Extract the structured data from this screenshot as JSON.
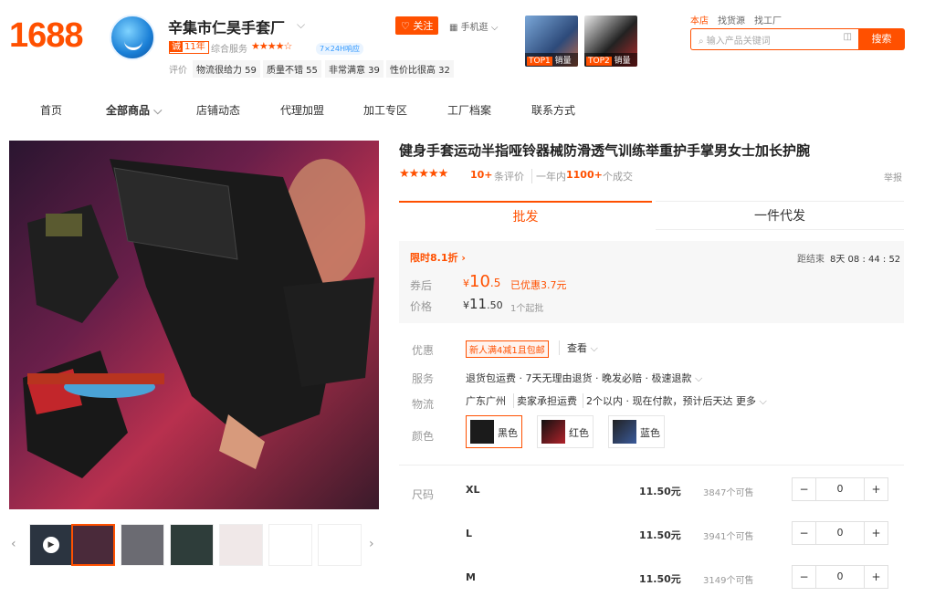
{
  "logo": "1688",
  "shop": {
    "name": "辛集市仁昊手套厂",
    "years_badge_icon": "诚",
    "years": "11年",
    "overall_service_label": "综合服务",
    "stars": "★★★★☆",
    "service_badge": "7×24H响应",
    "follow_label": "关注",
    "mobile_label": "手机逛",
    "eval_label": "评价",
    "evaluations": [
      "物流很给力 59",
      "质量不错 55",
      "非常满意 39",
      "性价比很高 32"
    ]
  },
  "top_products": [
    {
      "rank": "TOP1",
      "label": "销量"
    },
    {
      "rank": "TOP2",
      "label": "销量"
    }
  ],
  "header_links": [
    "本店",
    "找货源",
    "找工厂"
  ],
  "search": {
    "placeholder": "输入产品关键词",
    "button": "搜索"
  },
  "nav": [
    "首页",
    "全部商品",
    "店铺动态",
    "代理加盟",
    "加工专区",
    "工厂档案",
    "联系方式"
  ],
  "product": {
    "title": "健身手套运动半指哑铃器械防滑透气训练举重护手掌男女士加长护腕",
    "rating_stars": "★★★★★",
    "reviews_count": "10+",
    "reviews_label": "条评价",
    "year_label": "一年内",
    "year_sales": "1100+",
    "deals_label": "个成交",
    "report": "举报"
  },
  "tabs": [
    "批发",
    "一件代发"
  ],
  "promo": {
    "label": "限时8.1折",
    "countdown_label": "距结束",
    "countdown": "8天 08 : 44 : 52",
    "coupon_label": "券后",
    "coupon_currency": "¥",
    "coupon_int": "10",
    "coupon_dec": ".5",
    "discount": "已优惠3.7元",
    "price_label": "价格",
    "price_currency": "¥",
    "price_int": "11",
    "price_dec": ".50",
    "moq": "1个起批"
  },
  "offers": {
    "label": "优惠",
    "tag": "新人满4减1且包邮",
    "view": "查看"
  },
  "service": {
    "label": "服务",
    "text": "退货包运费 · 7天无理由退货 · 晚发必赔 · 极速退款"
  },
  "logistics": {
    "label": "物流",
    "location": "广东广州",
    "fee": "卖家承担运费",
    "shipping": "2个以内 · 现在付款，预计后天达",
    "more": "更多"
  },
  "colors": {
    "label": "颜色",
    "options": [
      "黑色",
      "红色",
      "蓝色"
    ]
  },
  "sizes": {
    "label": "尺码",
    "rows": [
      {
        "size": "XL",
        "price": "11.50元",
        "avail": "3847个可售",
        "qty": "0"
      },
      {
        "size": "L",
        "price": "11.50元",
        "avail": "3941个可售",
        "qty": "0"
      },
      {
        "size": "M",
        "price": "11.50元",
        "avail": "3149个可售",
        "qty": "0"
      }
    ]
  },
  "stepper": {
    "minus": "−",
    "plus": "+"
  },
  "accent": "#ff5000"
}
